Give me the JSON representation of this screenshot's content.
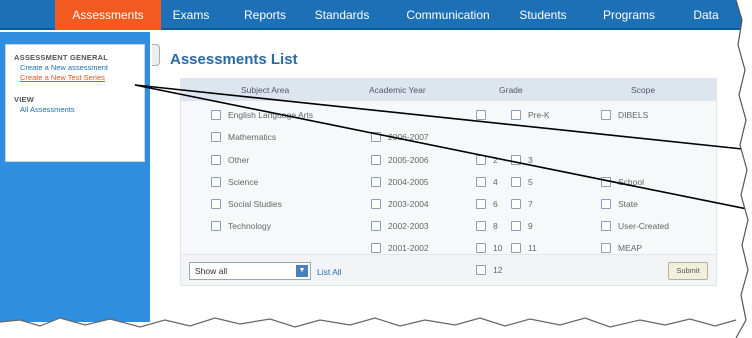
{
  "nav": {
    "items": [
      {
        "label": "Assessments",
        "active": true
      },
      {
        "label": "Exams"
      },
      {
        "label": "Reports"
      },
      {
        "label": "Standards"
      },
      {
        "label": "Communication"
      },
      {
        "label": "Students"
      },
      {
        "label": "Programs"
      },
      {
        "label": "Data"
      }
    ]
  },
  "sidebar": {
    "heading_general": "ASSESSMENT GENERAL",
    "link_create_assessment": "Create a New assessment",
    "link_create_test_series": "Create a New Test Series",
    "heading_view": "VIEW",
    "link_all_assessments": "All Assessments"
  },
  "main": {
    "title": "Assessments List",
    "columns": {
      "subject": "Subject Area",
      "year": "Academic Year",
      "grade": "Grade",
      "scope": "Scope"
    },
    "subjects": [
      "English Language Arts",
      "Mathematics",
      "Other",
      "Science",
      "Social Studies",
      "Technology"
    ],
    "years": [
      "2006-2007",
      "2005-2006",
      "2004-2005",
      "2003-2004",
      "2002-2003",
      "2001-2002"
    ],
    "grades": [
      "Pre-K",
      "2",
      "3",
      "4",
      "5",
      "6",
      "7",
      "8",
      "9",
      "10",
      "11",
      "12"
    ],
    "scopes": [
      "DIBELS",
      "School",
      "State",
      "User-Created",
      "MEAP"
    ],
    "show_select": "Show all",
    "list_all": "List All",
    "submit": "Submit"
  },
  "colors": {
    "nav_bg": "#1d6fb6",
    "nav_active": "#f25a1f",
    "sidebar_bg": "#2e8ee0",
    "title": "#2a6aa5",
    "link_active": "#e8531b"
  }
}
